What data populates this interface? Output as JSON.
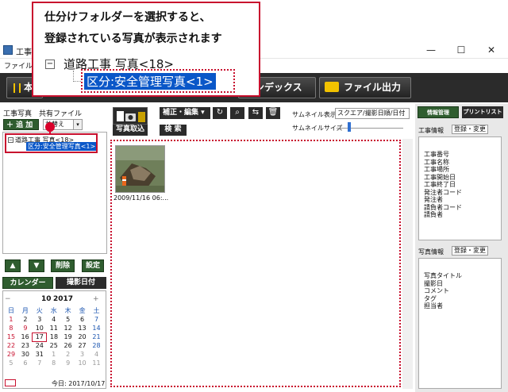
{
  "window": {
    "title": "工事写",
    "menu_file": "ファイル(F)",
    "min_glyph": "—",
    "max_glyph": "☐",
    "close_glyph": "✕"
  },
  "toolbar": {
    "book_label": "本",
    "index_label": "インデックス",
    "export_label": "ファイル出力",
    "book_icon": "book-icon",
    "export_icon": "folder-icon"
  },
  "left": {
    "tabs_label": "工事写真　共有ファイル",
    "add_label": "＋ 追 加",
    "sort_value": "並替え",
    "tree_parent": "道路工事 写真<18>",
    "tree_child": "区分:安全管理写真<1>",
    "up_label": "▲",
    "down_label": "▼",
    "delete_label": "削除",
    "settings_label": "設定",
    "calendar_tab": "カレンダー",
    "shot_date_tab": "撮影日付"
  },
  "calendar": {
    "prev": "−",
    "next": "+",
    "month": "10",
    "year": "2017",
    "weekdays": [
      "日",
      "月",
      "火",
      "水",
      "木",
      "金",
      "土"
    ],
    "weeks": [
      [
        "1",
        "2",
        "3",
        "4",
        "5",
        "6",
        "7"
      ],
      [
        "8",
        "9",
        "10",
        "11",
        "12",
        "13",
        "14"
      ],
      [
        "15",
        "16",
        "17",
        "18",
        "19",
        "20",
        "21"
      ],
      [
        "22",
        "23",
        "24",
        "25",
        "26",
        "27",
        "28"
      ],
      [
        "29",
        "30",
        "31",
        "1",
        "2",
        "3",
        "4"
      ],
      [
        "5",
        "6",
        "7",
        "8",
        "9",
        "10",
        "11"
      ]
    ],
    "today_label": "今日: 2017/10/17"
  },
  "center": {
    "import_label": "写真取込",
    "edit_label": "補正・編集 ▾",
    "search_label": "検 索",
    "rotate_icon": "↻",
    "zoom_icon": "⌕",
    "swap_icon": "⇆",
    "trash_icon": "🗑",
    "thumb_display_label": "サムネイル表示",
    "thumb_display_value": "スクエア/撮影日順/日付",
    "thumb_size_label": "サムネイルサイズ",
    "photo_caption": "2009/11/16 06:..."
  },
  "right": {
    "tab_info": "情報管理",
    "tab_print": "プリントリスト",
    "work_info_label": "工事情報",
    "work_edit_label": "登録・変更",
    "work_fields": [
      "工事番号",
      "工事名称",
      "工事場所",
      "工事開始日",
      "工事終了日",
      "発注者コード",
      "発注者",
      "請負者コード",
      "請負者"
    ],
    "photo_info_label": "写真情報",
    "photo_edit_label": "登録・変更",
    "photo_fields": [
      "写真タイトル",
      "撮影日",
      "コメント",
      "タグ",
      "担当者"
    ]
  },
  "callout": {
    "line1": "仕分けフォルダーを選択すると、",
    "line2": "登録されている写真が表示されます",
    "tree_parent": "道路工事 写真<18>",
    "tree_child": "区分:安全管理写真<1>"
  },
  "colors": {
    "accent_red": "#c8102e",
    "selection_blue": "#0a57c8",
    "green_button": "#2f5d2f",
    "dark_toolbar": "#2b2b2b"
  }
}
